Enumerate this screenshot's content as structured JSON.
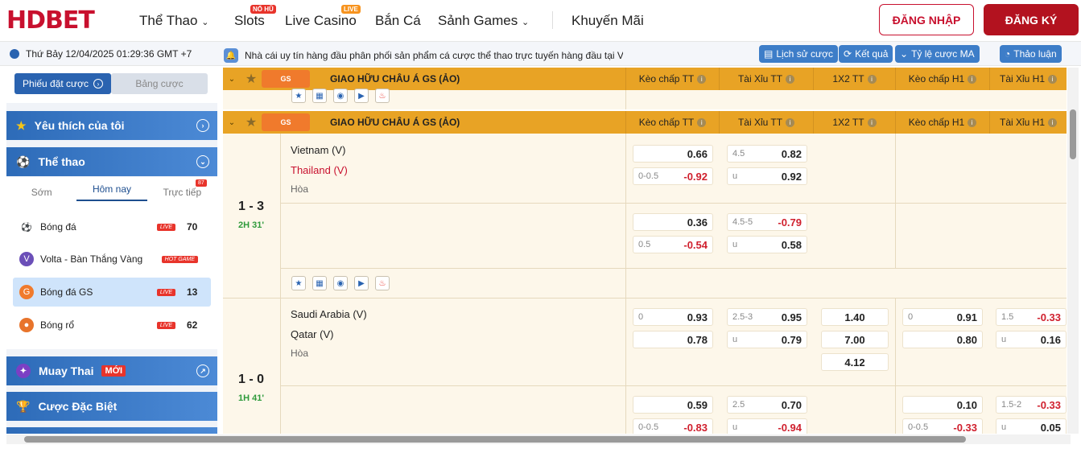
{
  "brand": {
    "logo": "HDBET"
  },
  "nav": {
    "sports": "Thể Thao",
    "slots": "Slots",
    "slots_badge": "NỔ HŨ",
    "casino": "Live Casino",
    "casino_badge": "LIVE",
    "fish": "Bắn Cá",
    "games": "Sảnh Games",
    "promo": "Khuyến Mãi",
    "login": "ĐĂNG NHẬP",
    "register": "ĐĂNG KÝ"
  },
  "subbar": {
    "datetime": "Thứ Bảy 12/04/2025 01:29:36 GMT +7",
    "notice": "Nhà cái uy tín hàng đầu phân phối sản phẩm cá cược thể thao trực tuyến hàng đầu tại Việt Nam.",
    "bet_history": "Lịch sử cược",
    "results": "Kết quả",
    "odds_type": "Tỷ lệ cược MA",
    "discussion": "Thảo luận"
  },
  "sidebar": {
    "slip_tab": "Phiếu đặt cược",
    "odds_tab": "Bảng cược",
    "favorites": "Yêu thích của tôi",
    "sports": "Thể thao",
    "tabs": [
      "Sớm",
      "Hôm nay",
      "Trực tiếp"
    ],
    "live_count_badge": "87",
    "items": [
      {
        "name": "Bóng đá",
        "tag": "LIVE",
        "count": "70"
      },
      {
        "name": "Volta - Bàn Thắng Vàng",
        "tag": "HOT GAME",
        "count": ""
      },
      {
        "name": "Bóng đá GS",
        "tag": "LIVE",
        "count": "13"
      },
      {
        "name": "Bóng rổ",
        "tag": "LIVE",
        "count": "62"
      }
    ],
    "muay": "Muay Thai",
    "muay_badge": "MỚI",
    "special": "Cược Đặc Biệt"
  },
  "league": {
    "name": "GIAO HỮU CHÂU Á GS (ẢO)",
    "logo_text": "GS",
    "columns": [
      "Kèo chấp TT",
      "Tài Xỉu TT",
      "1X2 TT",
      "Kèo chấp H1",
      "Tài Xỉu H1"
    ]
  },
  "matches": [
    {
      "home": "Vietnam (V)",
      "away": "Thailand (V)",
      "draw": "Hòa",
      "score": "1 - 3",
      "time": "2H 31'",
      "lines": [
        {
          "hdp_home": {
            "h": "",
            "v": "0.66"
          },
          "hdp_away": {
            "h": "0-0.5",
            "v": "-0.92"
          },
          "ou_over": {
            "h": "4.5",
            "v": "0.82"
          },
          "ou_under": {
            "h": "u",
            "v": "0.92"
          }
        },
        {
          "hdp_home": {
            "h": "",
            "v": "0.36"
          },
          "hdp_away": {
            "h": "0.5",
            "v": "-0.54"
          },
          "ou_over": {
            "h": "4.5-5",
            "v": "-0.79"
          },
          "ou_under": {
            "h": "u",
            "v": "0.58"
          }
        }
      ]
    },
    {
      "home": "Saudi Arabia (V)",
      "away": "Qatar (V)",
      "draw": "Hòa",
      "score": "1 - 0",
      "time": "1H 41'",
      "line1": {
        "hdp_home": {
          "h": "0",
          "v": "0.93"
        },
        "hdp_away": {
          "h": "",
          "v": "0.78"
        },
        "ou_over": {
          "h": "2.5-3",
          "v": "0.95"
        },
        "ou_under": {
          "h": "u",
          "v": "0.79"
        },
        "x12": [
          "1.40",
          "7.00",
          "4.12"
        ],
        "h1_hdp_home": {
          "h": "0",
          "v": "0.91"
        },
        "h1_hdp_away": {
          "h": "",
          "v": "0.80"
        },
        "h1_ou_over": {
          "h": "1.5",
          "v": "-0.33"
        },
        "h1_ou_under": {
          "h": "u",
          "v": "0.16"
        }
      },
      "line2": {
        "hdp_home": {
          "h": "",
          "v": "0.59"
        },
        "hdp_away": {
          "h": "0-0.5",
          "v": "-0.83"
        },
        "ou_over": {
          "h": "2.5",
          "v": "0.70"
        },
        "ou_under": {
          "h": "u",
          "v": "-0.94"
        },
        "h1_hdp_home": {
          "h": "",
          "v": "0.10"
        },
        "h1_hdp_away": {
          "h": "0-0.5",
          "v": "-0.33"
        },
        "h1_ou_over": {
          "h": "1.5-2",
          "v": "-0.33"
        },
        "h1_ou_under": {
          "h": "u",
          "v": "0.05"
        }
      }
    }
  ],
  "colors": {
    "brand_red": "#c8102e",
    "league_bar": "#e8a325",
    "sidebar_blue": "#2d6bb8",
    "negative": "#d0202e",
    "live_time": "#2e9a3b"
  }
}
